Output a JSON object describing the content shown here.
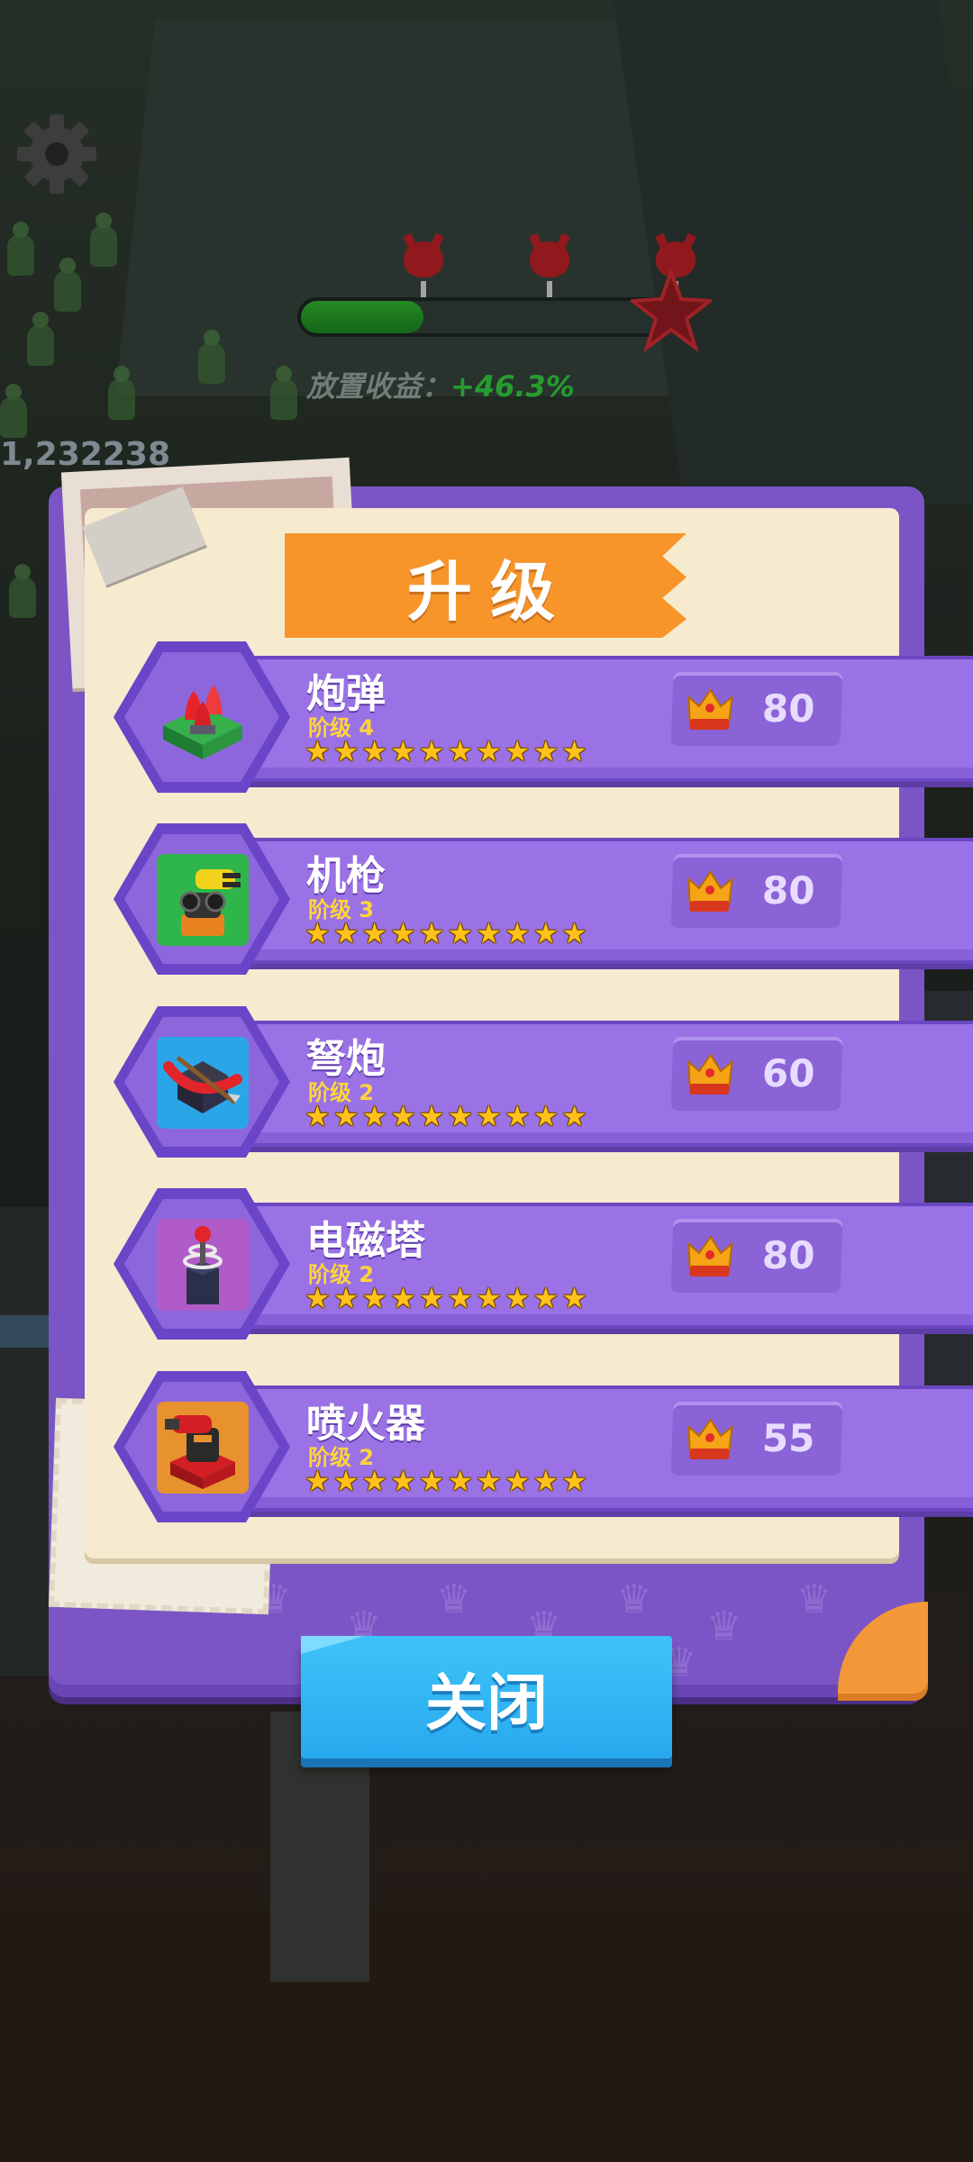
{
  "scene": {
    "idle_income_label": "放置收益：",
    "idle_income_value": "+46.3%",
    "side_counter": "1,232238"
  },
  "hud": {
    "wave_progress": 0.33
  },
  "dialog": {
    "title": "升级",
    "close_label": "关闭",
    "items": [
      {
        "name": "炮弹",
        "level": "阶级 4",
        "cost": "80",
        "stars": 10
      },
      {
        "name": "机枪",
        "level": "阶级 3",
        "cost": "80",
        "stars": 10
      },
      {
        "name": "弩炮",
        "level": "阶级 2",
        "cost": "60",
        "stars": 10
      },
      {
        "name": "电磁塔",
        "level": "阶级 2",
        "cost": "80",
        "stars": 10
      },
      {
        "name": "喷火器",
        "level": "阶级 2",
        "cost": "55",
        "stars": 10
      }
    ]
  },
  "icons": {
    "settings": "gear-icon",
    "currency": "crown-icon",
    "wave": "devil-icon",
    "rating": "star-icon"
  },
  "colors": {
    "panel": "#7b55c6",
    "paper": "#f6ebcf",
    "banner": "#f7952b",
    "row": "#9a72e6",
    "close_button": "#3ec3f8",
    "level_text": "#ffd43a",
    "star": "#ffc21c"
  }
}
